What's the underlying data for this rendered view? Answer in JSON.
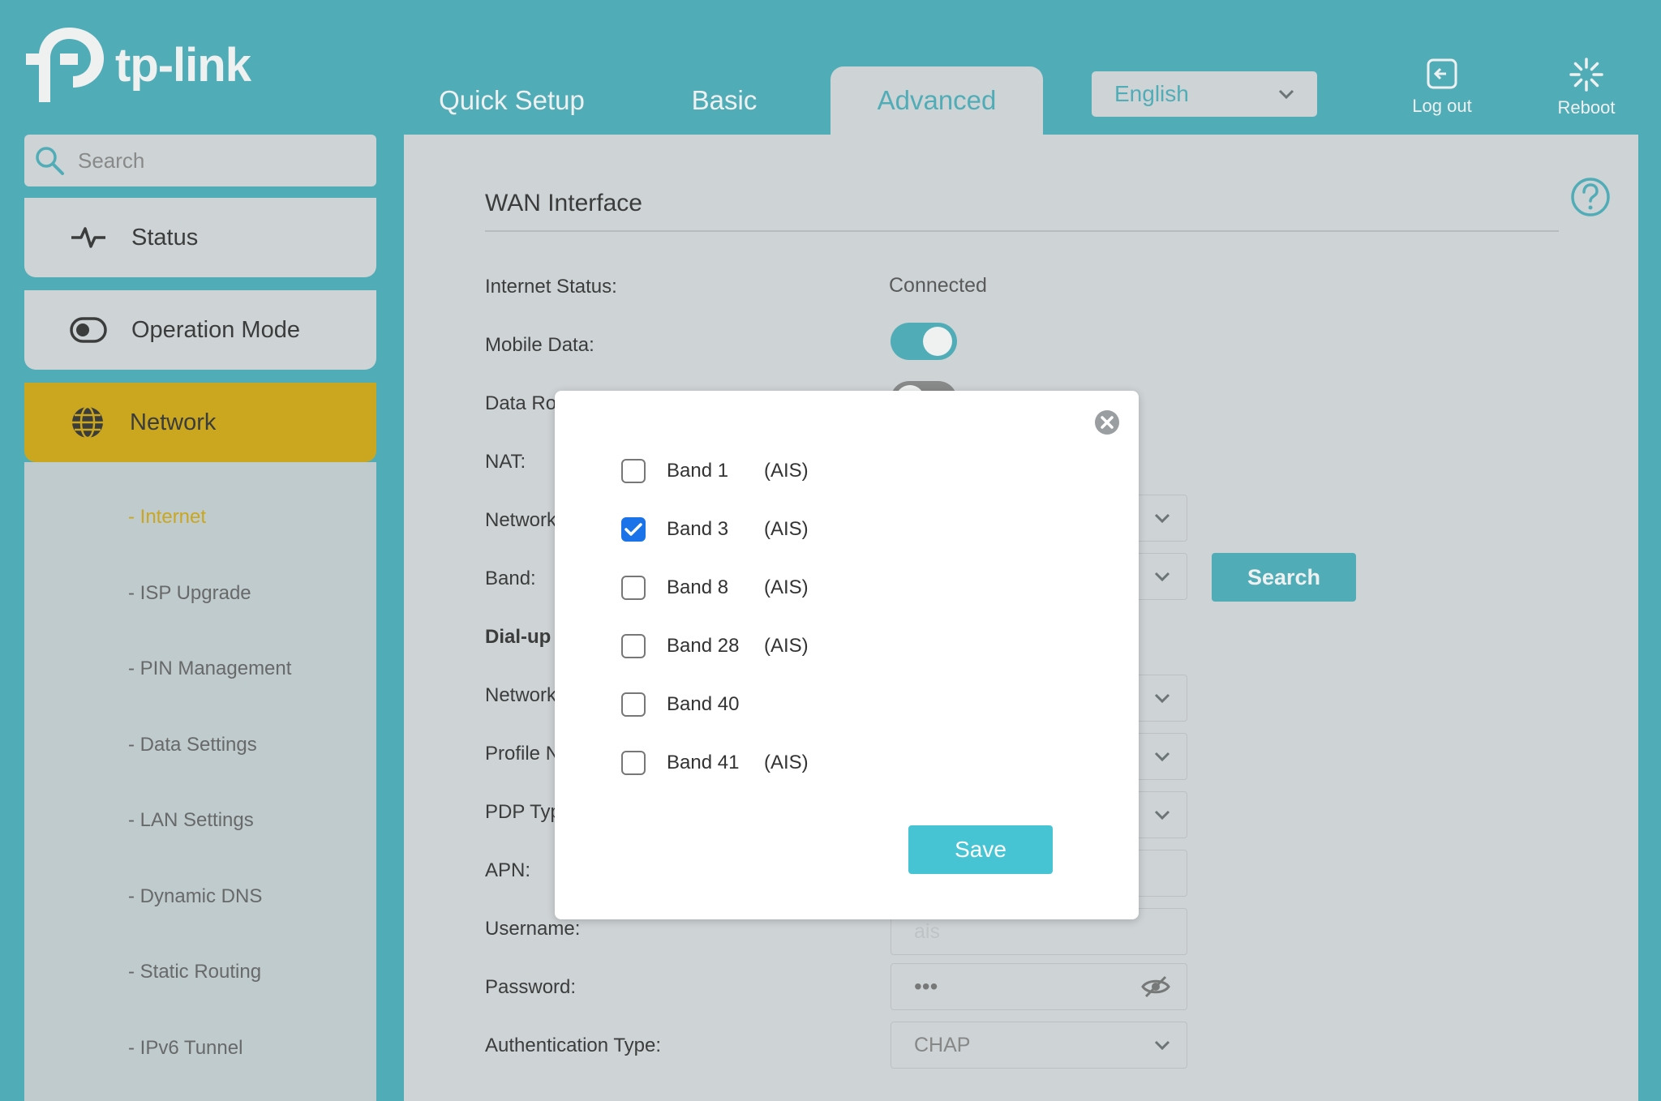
{
  "brand": {
    "logo_text": "tp-link"
  },
  "topnav": {
    "tabs": [
      {
        "label": "Quick Setup",
        "active": false
      },
      {
        "label": "Basic",
        "active": false
      },
      {
        "label": "Advanced",
        "active": true
      }
    ],
    "language": "English",
    "logout_label": "Log out",
    "reboot_label": "Reboot"
  },
  "sidebar": {
    "search_placeholder": "Search",
    "items": [
      {
        "label": "Status",
        "icon": "pulse-icon"
      },
      {
        "label": "Operation Mode",
        "icon": "toggle-mode-icon"
      },
      {
        "label": "Network",
        "icon": "globe-icon",
        "active": true
      }
    ],
    "subitems": [
      "- Internet",
      "- ISP Upgrade",
      "- PIN Management",
      "- Data Settings",
      "- LAN Settings",
      "- Dynamic DNS",
      "- Static Routing",
      "- IPv6 Tunnel"
    ]
  },
  "main": {
    "section_title": "WAN Interface",
    "internet_status_label": "Internet Status:",
    "internet_status_value": "Connected",
    "mobile_data_label": "Mobile Data:",
    "mobile_data_on": true,
    "data_roaming_label": "Data Ro",
    "nat_label": "NAT:",
    "network_label": "Network",
    "band_label": "Band:",
    "search_button": "Search",
    "dialup_label": "Dial-up",
    "network2_label": "Network",
    "profile_label": "Profile N",
    "pdp_label": "PDP Typ",
    "apn_label": "APN:",
    "username_label": "Username:",
    "username_placeholder": "ais",
    "password_label": "Password:",
    "password_mask": "•••",
    "auth_label": "Authentication Type:",
    "auth_value": "CHAP"
  },
  "modal": {
    "bands": [
      {
        "name": "Band 1",
        "operator": "(AIS)",
        "checked": false
      },
      {
        "name": "Band 3",
        "operator": "(AIS)",
        "checked": true
      },
      {
        "name": "Band 8",
        "operator": "(AIS)",
        "checked": false
      },
      {
        "name": "Band 28",
        "operator": "(AIS)",
        "checked": false
      },
      {
        "name": "Band 40",
        "operator": "",
        "checked": false
      },
      {
        "name": "Band 41",
        "operator": "(AIS)",
        "checked": false
      }
    ],
    "save_label": "Save"
  },
  "colors": {
    "teal": "#4bb3bf",
    "gold": "#d6ac12",
    "panel": "#dadfe1",
    "checkbox_blue": "#1a73e8"
  }
}
